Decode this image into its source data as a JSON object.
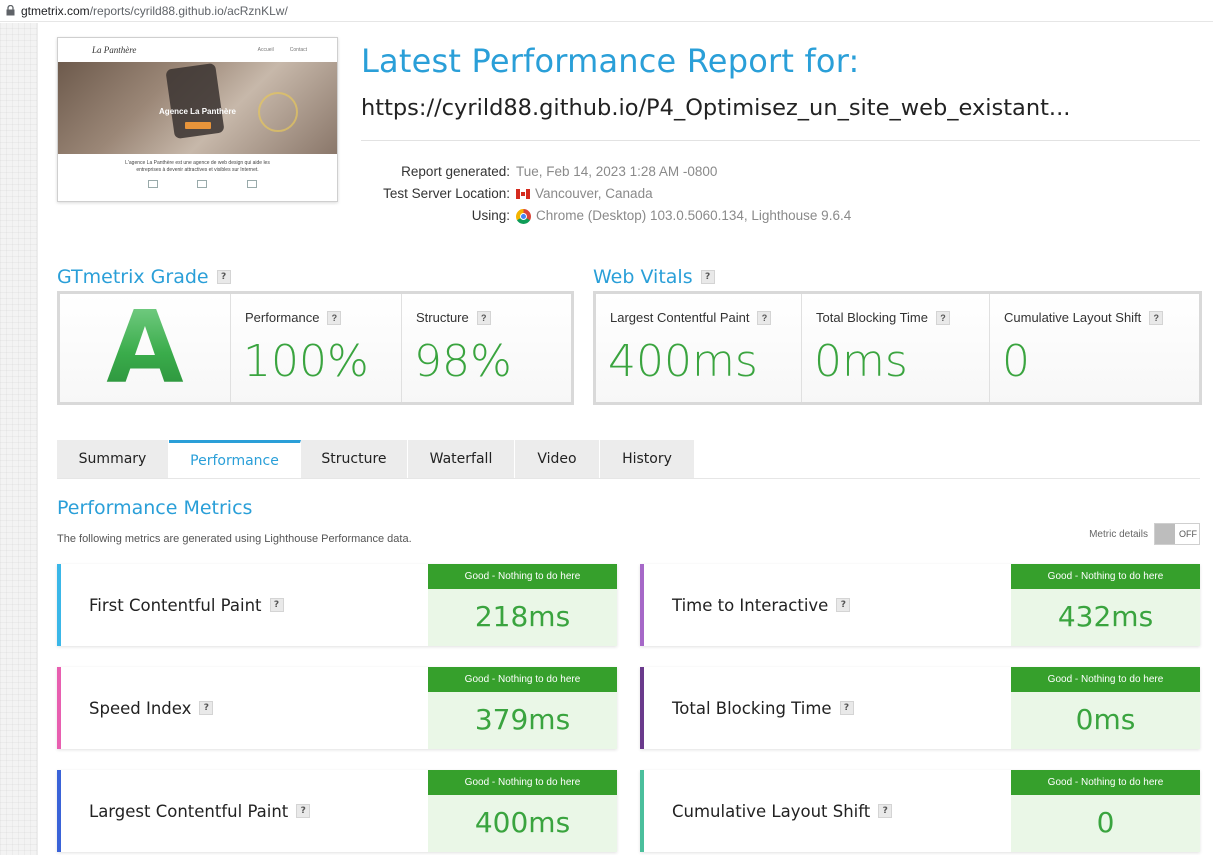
{
  "browser": {
    "url_domain": "gtmetrix.com",
    "url_path": "/reports/cyrild88.github.io/acRznKLw/"
  },
  "thumbnail": {
    "logo": "La Panthère",
    "nav": [
      "Accueil",
      "Contact"
    ],
    "hero_text": "Agence La Panthère",
    "body_text": "L'agence La Panthère est une agence de web design qui aide les entreprises à devenir attractives et visibles sur Internet."
  },
  "header": {
    "title": "Latest Performance Report for:",
    "url": "https://cyrild88.github.io/P4_Optimisez_un_site_web_existant..."
  },
  "meta": {
    "report_generated_label": "Report generated:",
    "report_generated_value": "Tue, Feb 14, 2023 1:28 AM -0800",
    "server_label": "Test Server Location:",
    "server_value": "Vancouver, Canada",
    "using_label": "Using:",
    "using_value": "Chrome (Desktop) 103.0.5060.134, Lighthouse 9.6.4"
  },
  "grade": {
    "title": "GTmetrix Grade",
    "letter": "A",
    "performance_label": "Performance",
    "performance_value": "100%",
    "structure_label": "Structure",
    "structure_value": "98%"
  },
  "vitals": {
    "title": "Web Vitals",
    "lcp_label": "Largest Contentful Paint",
    "lcp_value": "400ms",
    "tbt_label": "Total Blocking Time",
    "tbt_value": "0ms",
    "cls_label": "Cumulative Layout Shift",
    "cls_value": "0"
  },
  "tabs": [
    "Summary",
    "Performance",
    "Structure",
    "Waterfall",
    "Video",
    "History"
  ],
  "active_tab": "Performance",
  "perf_metrics": {
    "title": "Performance Metrics",
    "subtitle": "The following metrics are generated using Lighthouse Performance data.",
    "metric_details_label": "Metric details",
    "toggle_state": "OFF",
    "cards": [
      {
        "label": "First Contentful Paint",
        "status": "Good - Nothing to do here",
        "value": "218ms",
        "color": "#3ab7e8"
      },
      {
        "label": "Time to Interactive",
        "status": "Good - Nothing to do here",
        "value": "432ms",
        "color": "#a668c8"
      },
      {
        "label": "Speed Index",
        "status": "Good - Nothing to do here",
        "value": "379ms",
        "color": "#e85fb0"
      },
      {
        "label": "Total Blocking Time",
        "status": "Good - Nothing to do here",
        "value": "0ms",
        "color": "#6a3a8c"
      },
      {
        "label": "Largest Contentful Paint",
        "status": "Good - Nothing to do here",
        "value": "400ms",
        "color": "#3a63d8"
      },
      {
        "label": "Cumulative Layout Shift",
        "status": "Good - Nothing to do here",
        "value": "0",
        "color": "#4bbf9c"
      }
    ]
  },
  "colors": {
    "accent": "#2a9fd8",
    "good": "#36a02c",
    "value_green": "#3aa43f"
  }
}
